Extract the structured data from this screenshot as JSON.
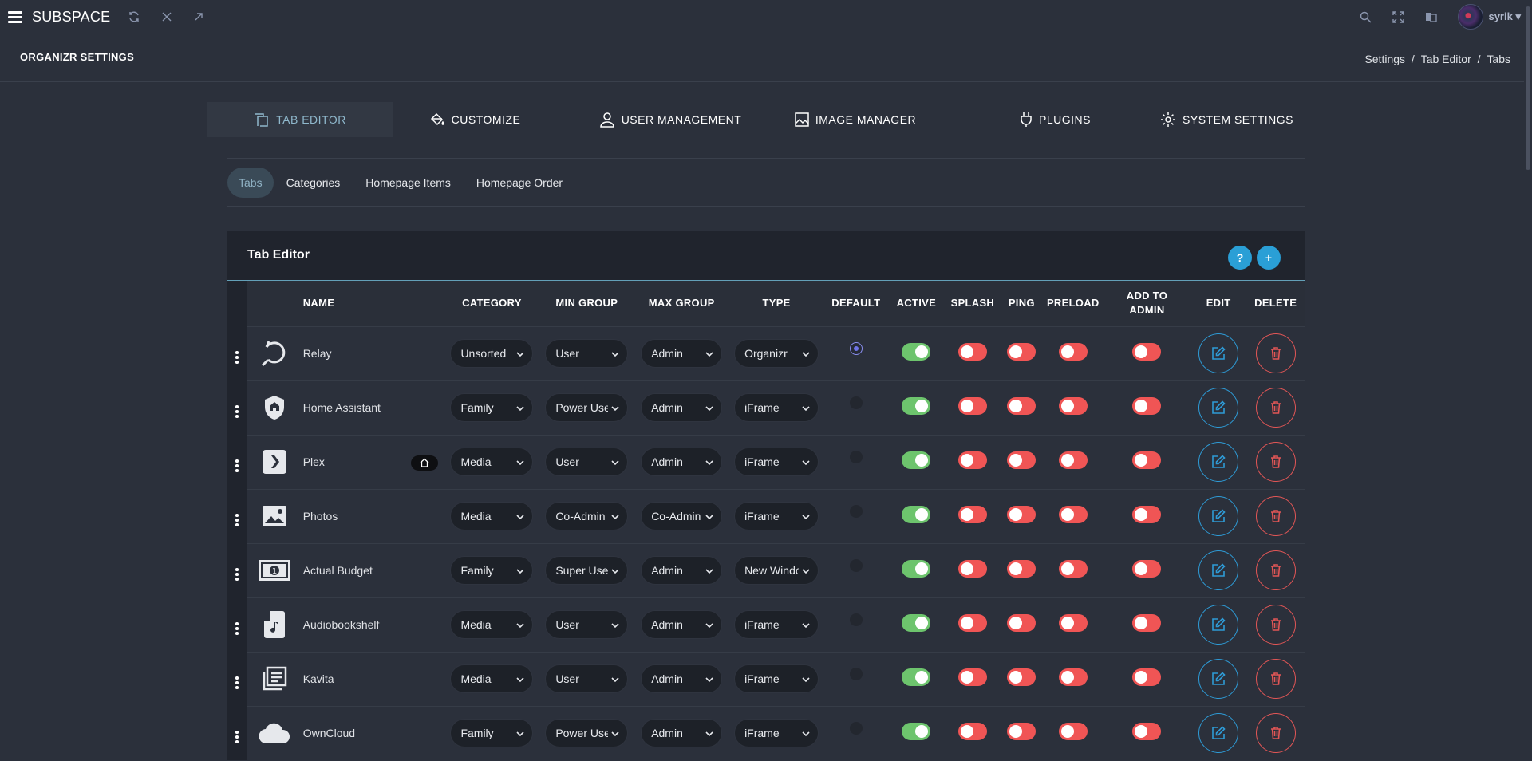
{
  "app": {
    "brand": "SUBSPACE",
    "username": "syrik"
  },
  "page": {
    "title": "ORGANIZR SETTINGS",
    "breadcrumb": [
      "Settings",
      "Tab Editor",
      "Tabs"
    ],
    "breadcrumb_sep": "/"
  },
  "main_tabs": [
    {
      "label": "TAB EDITOR",
      "icon": "tab-editor-icon",
      "active": true
    },
    {
      "label": "CUSTOMIZE",
      "icon": "paint-bucket-icon",
      "active": false
    },
    {
      "label": "USER MANAGEMENT",
      "icon": "user-icon",
      "active": false
    },
    {
      "label": "IMAGE MANAGER",
      "icon": "image-icon",
      "active": false
    },
    {
      "label": "PLUGINS",
      "icon": "plug-icon",
      "active": false
    },
    {
      "label": "SYSTEM SETTINGS",
      "icon": "gear-icon",
      "active": false
    }
  ],
  "sub_tabs": [
    {
      "label": "Tabs",
      "active": true
    },
    {
      "label": "Categories",
      "active": false
    },
    {
      "label": "Homepage Items",
      "active": false
    },
    {
      "label": "Homepage Order",
      "active": false
    }
  ],
  "panel": {
    "title": "Tab Editor",
    "help_glyph": "?",
    "add_glyph": "+"
  },
  "columns": {
    "name": "NAME",
    "category": "CATEGORY",
    "min_group": "MIN GROUP",
    "max_group": "MAX GROUP",
    "type": "TYPE",
    "default": "DEFAULT",
    "active": "ACTIVE",
    "splash": "SPLASH",
    "ping": "PING",
    "preload": "PRELOAD",
    "add_to_admin_line1": "ADD TO",
    "add_to_admin_line2": "ADMIN",
    "edit": "EDIT",
    "delete": "DELETE"
  },
  "rows": [
    {
      "name": "Relay",
      "icon": "relay-icon",
      "home": false,
      "category": "Unsorted",
      "min_group": "User",
      "max_group": "Admin",
      "type": "Organizr",
      "default": true,
      "active": true,
      "splash": false,
      "ping": false,
      "preload": false,
      "add_to_admin": false
    },
    {
      "name": "Home Assistant",
      "icon": "home-shield-icon",
      "home": false,
      "category": "Family",
      "min_group": "Power User",
      "max_group": "Admin",
      "type": "iFrame",
      "default": false,
      "active": true,
      "splash": false,
      "ping": false,
      "preload": false,
      "add_to_admin": false
    },
    {
      "name": "Plex",
      "icon": "plex-icon",
      "home": true,
      "category": "Media",
      "min_group": "User",
      "max_group": "Admin",
      "type": "iFrame",
      "default": false,
      "active": true,
      "splash": false,
      "ping": false,
      "preload": false,
      "add_to_admin": false
    },
    {
      "name": "Photos",
      "icon": "photos-icon",
      "home": false,
      "category": "Media",
      "min_group": "Co-Admin",
      "max_group": "Co-Admin",
      "type": "iFrame",
      "default": false,
      "active": true,
      "splash": false,
      "ping": false,
      "preload": false,
      "add_to_admin": false
    },
    {
      "name": "Actual Budget",
      "icon": "money-icon",
      "home": false,
      "category": "Family",
      "min_group": "Super User",
      "max_group": "Admin",
      "type": "New Window",
      "default": false,
      "active": true,
      "splash": false,
      "ping": false,
      "preload": false,
      "add_to_admin": false
    },
    {
      "name": "Audiobookshelf",
      "icon": "audiobook-icon",
      "home": false,
      "category": "Media",
      "min_group": "User",
      "max_group": "Admin",
      "type": "iFrame",
      "default": false,
      "active": true,
      "splash": false,
      "ping": false,
      "preload": false,
      "add_to_admin": false
    },
    {
      "name": "Kavita",
      "icon": "library-icon",
      "home": false,
      "category": "Media",
      "min_group": "User",
      "max_group": "Admin",
      "type": "iFrame",
      "default": false,
      "active": true,
      "splash": false,
      "ping": false,
      "preload": false,
      "add_to_admin": false
    },
    {
      "name": "OwnCloud",
      "icon": "cloud-icon",
      "home": false,
      "category": "Family",
      "min_group": "Power User",
      "max_group": "Admin",
      "type": "iFrame",
      "default": false,
      "active": true,
      "splash": false,
      "ping": false,
      "preload": false,
      "add_to_admin": false
    }
  ],
  "colors": {
    "accent": "#2a9fd6",
    "toggle_on": "#6dc46d",
    "toggle_off": "#f05555",
    "delete": "#e25656",
    "background": "#2b303b"
  }
}
